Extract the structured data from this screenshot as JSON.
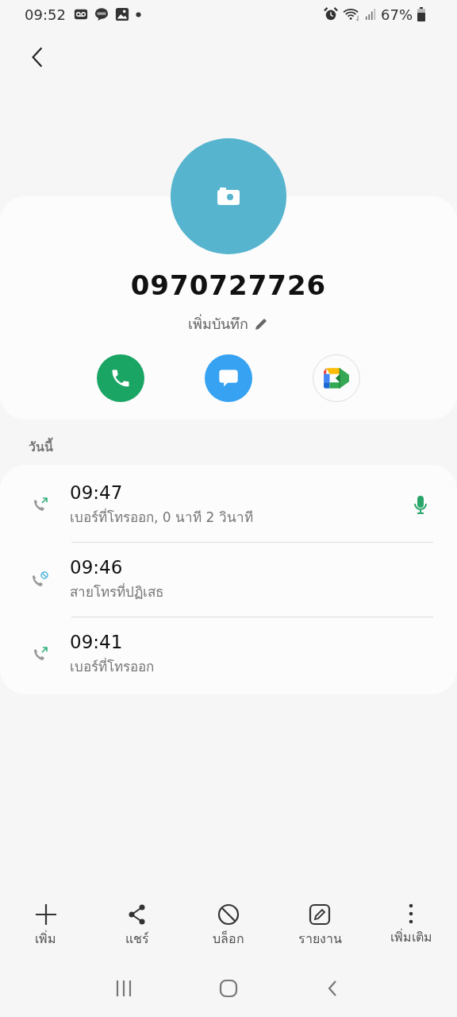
{
  "status_bar": {
    "time": "09:52",
    "battery": "67%"
  },
  "contact": {
    "number": "0970727726",
    "note_label": "เพิ่มบันทึก"
  },
  "section_title": "วันนี้",
  "calls": [
    {
      "kind": "outgoing",
      "time": "09:47",
      "detail": "เบอร์ที่โทรออก, 0 นาที 2 วินาที",
      "recorded": true
    },
    {
      "kind": "rejected",
      "time": "09:46",
      "detail": "สายโทรที่ปฏิเสธ",
      "recorded": false
    },
    {
      "kind": "outgoing",
      "time": "09:41",
      "detail": "เบอร์ที่โทรออก",
      "recorded": false
    }
  ],
  "bottom_actions": [
    {
      "kind": "add",
      "label": "เพิ่ม"
    },
    {
      "kind": "share",
      "label": "แชร์"
    },
    {
      "kind": "block",
      "label": "บล็อก"
    },
    {
      "kind": "report",
      "label": "รายงาน"
    },
    {
      "kind": "more",
      "label": "เพิ่มเติม"
    }
  ]
}
